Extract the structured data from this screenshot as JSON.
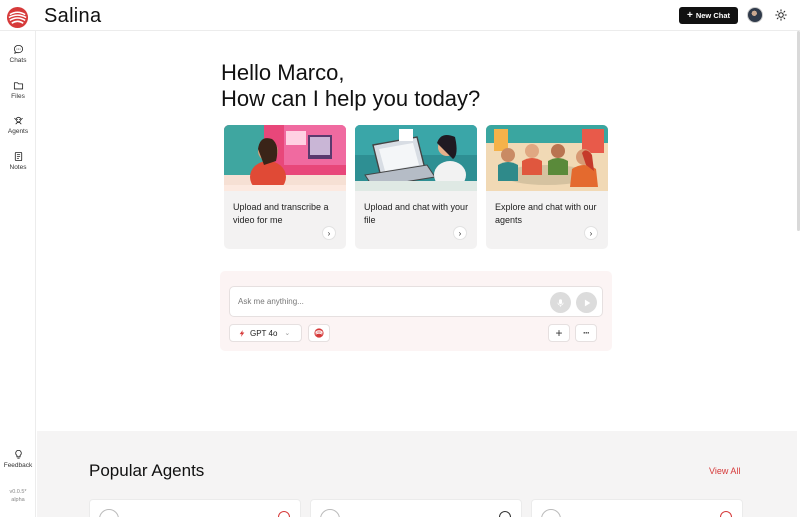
{
  "app": {
    "title": "Salina",
    "logo_icon": "salina-logo-icon",
    "brand_color": "#d63a3a"
  },
  "header": {
    "new_chat_label": "New Chat",
    "new_chat_icon": "plus-icon",
    "avatar_icon": "user-avatar",
    "theme_icon": "sun-icon"
  },
  "sidebar": {
    "items": [
      {
        "label": "Chats",
        "icon": "chat-bubble-icon"
      },
      {
        "label": "Files",
        "icon": "folder-icon"
      },
      {
        "label": "Agents",
        "icon": "agents-icon"
      },
      {
        "label": "Notes",
        "icon": "notes-icon"
      }
    ],
    "feedback_label": "Feedback",
    "feedback_icon": "lightbulb-icon",
    "version_line1": "v0.0.5*",
    "version_line2": "alpha"
  },
  "main": {
    "greeting_line1": "Hello Marco,",
    "greeting_line2": "How can I help you today?",
    "cards": [
      {
        "text": "Upload and transcribe a video for me",
        "arrow_icon": "chevron-right-icon"
      },
      {
        "text": "Upload and chat with your file",
        "arrow_icon": "chevron-right-icon"
      },
      {
        "text": "Explore and chat with our agents",
        "arrow_icon": "chevron-right-icon"
      }
    ],
    "composer": {
      "placeholder": "Ask me anything...",
      "model_label": "GPT 4o",
      "model_icon": "openai-flash-icon",
      "mic_icon": "microphone-icon",
      "send_icon": "play-icon",
      "plus_label": "+",
      "more_label": "···"
    }
  },
  "popular": {
    "title": "Popular Agents",
    "view_all_label": "View All"
  }
}
